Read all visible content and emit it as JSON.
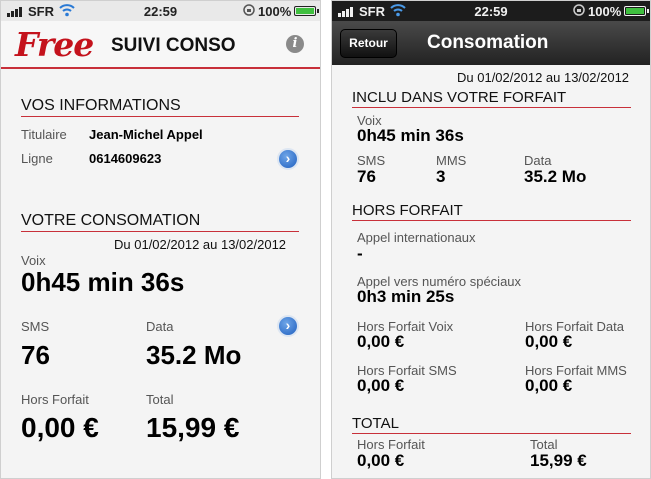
{
  "status_bar": {
    "carrier": "SFR",
    "time": "22:59",
    "battery": "100%",
    "battery_level": 1.0
  },
  "left": {
    "logo": "Free",
    "title": "SUIVI CONSO",
    "info_icon": "i",
    "vos_informations": {
      "heading": "VOS INFORMATIONS",
      "titulaire_label": "Titulaire",
      "titulaire_value": "Jean-Michel Appel",
      "ligne_label": "Ligne",
      "ligne_value": "0614609623"
    },
    "votre_consomation": {
      "heading": "VOTRE CONSOMATION",
      "date_range": "Du 01/02/2012 au 13/02/2012",
      "voix_label": "Voix",
      "voix_value": "0h45 min 36s",
      "sms_label": "SMS",
      "sms_value": "76",
      "data_label": "Data",
      "data_value": "35.2 Mo",
      "hors_forfait_label": "Hors Forfait",
      "hors_forfait_value": "0,00 €",
      "total_label": "Total",
      "total_value": "15,99 €"
    }
  },
  "right": {
    "back_button": "Retour",
    "title": "Consomation",
    "date_range": "Du 01/02/2012 au 13/02/2012",
    "inclus": {
      "heading": "INCLU DANS VOTRE FORFAIT",
      "voix_label": "Voix",
      "voix_value": "0h45 min 36s",
      "sms_label": "SMS",
      "sms_value": "76",
      "mms_label": "MMS",
      "mms_value": "3",
      "data_label": "Data",
      "data_value": "35.2 Mo"
    },
    "hors_forfait": {
      "heading": "HORS FORFAIT",
      "intl_label": "Appel internationaux",
      "intl_value": "-",
      "speciaux_label": "Appel vers numéro spéciaux",
      "speciaux_value": "0h3 min 25s",
      "hf_voix_label": "Hors Forfait Voix",
      "hf_voix_value": "0,00 €",
      "hf_data_label": "Hors Forfait Data",
      "hf_data_value": "0,00 €",
      "hf_sms_label": "Hors Forfait SMS",
      "hf_sms_value": "0,00 €",
      "hf_mms_label": "Hors Forfait MMS",
      "hf_mms_value": "0,00 €"
    },
    "total": {
      "heading": "TOTAL",
      "hors_forfait_label": "Hors Forfait",
      "hors_forfait_value": "0,00 €",
      "total_label": "Total",
      "total_value": "15,99 €"
    }
  }
}
